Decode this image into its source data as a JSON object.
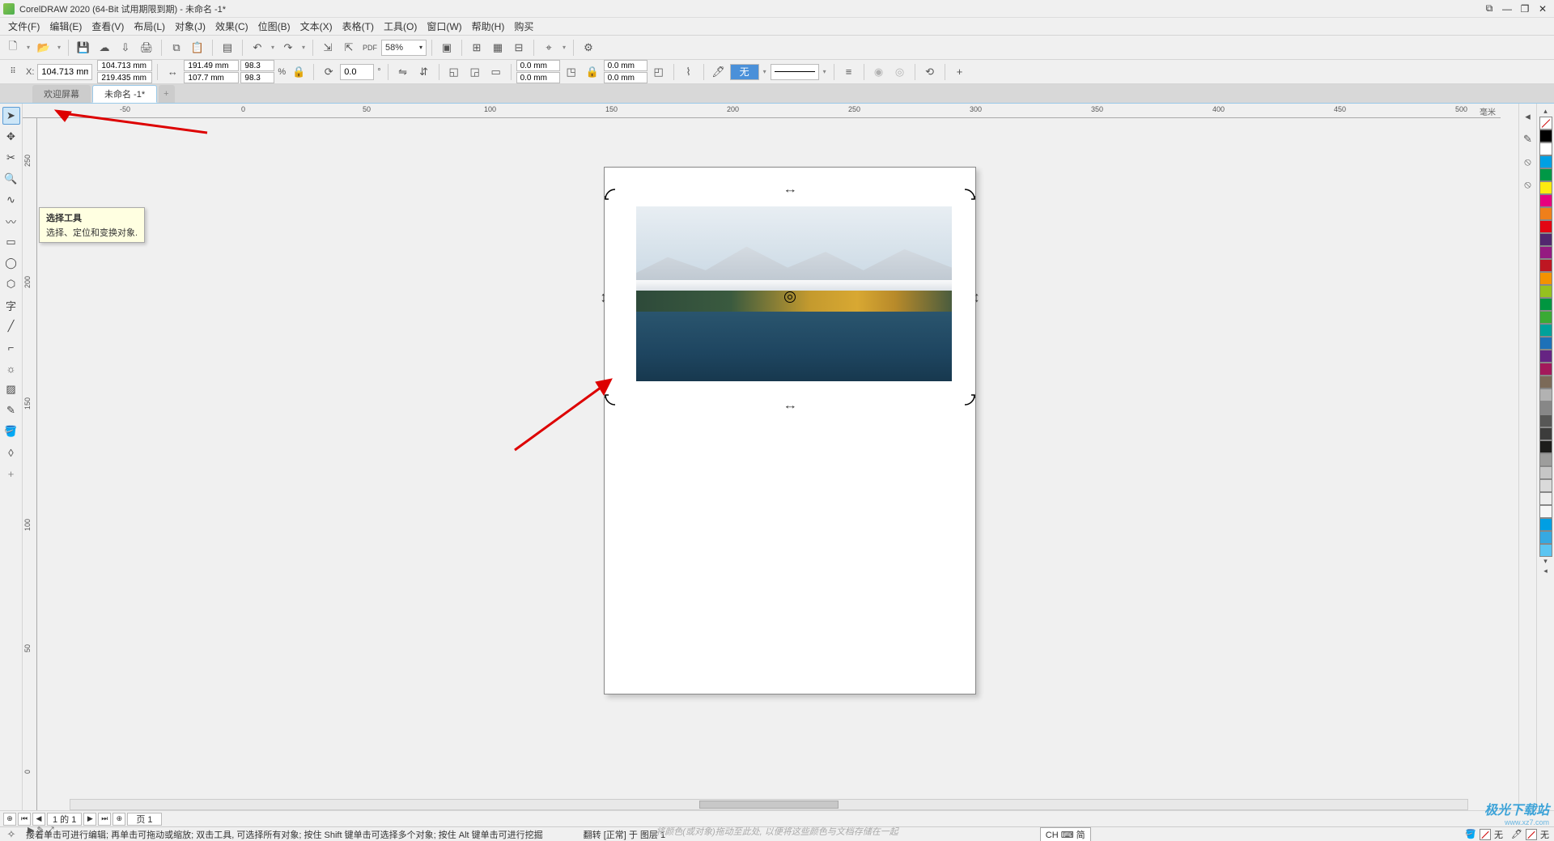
{
  "title": "CorelDRAW 2020 (64-Bit 试用期限到期) - 未命名 -1*",
  "menu": [
    "文件(F)",
    "编辑(E)",
    "查看(V)",
    "布局(L)",
    "对象(J)",
    "效果(C)",
    "位图(B)",
    "文本(X)",
    "表格(T)",
    "工具(O)",
    "窗口(W)",
    "帮助(H)",
    "购买"
  ],
  "toolbar1": {
    "zoom": "58%"
  },
  "propbar": {
    "x": "104.713 mm",
    "y": "219.435 mm",
    "w": "191.49 mm",
    "h": "107.7 mm",
    "sx": "98.3",
    "sy": "98.3",
    "sunit": "%",
    "rot": "0.0",
    "out1": "0.0 mm",
    "out2": "0.0 mm",
    "out3": "0.0 mm",
    "out4": "0.0 mm",
    "fill": "无"
  },
  "tabs": {
    "welcome": "欢迎屏幕",
    "doc": "未命名 -1*"
  },
  "tooltip": {
    "title": "选择工具",
    "desc": "选择、定位和变换对象."
  },
  "ruler_unit": "毫米",
  "hruler_ticks": [
    -50,
    0,
    50,
    100,
    150,
    200,
    250,
    300,
    350,
    400,
    450,
    500
  ],
  "vruler_ticks": [
    250,
    200,
    150,
    100,
    50,
    0
  ],
  "palette": [
    "#000000",
    "#ffffff",
    "#00a0e3",
    "#009846",
    "#fcea10",
    "#e6007e",
    "#ef7f1a",
    "#e30613",
    "#52286f",
    "#951b81",
    "#be1622",
    "#f39200",
    "#95c11f",
    "#009640",
    "#3aaa35",
    "#00a19a",
    "#1d71b8",
    "#662483",
    "#a3195b",
    "#7b6a58",
    "#b2b2b2",
    "#878787",
    "#575756",
    "#3c3c3b",
    "#1d1d1b",
    "#9d9d9c",
    "#c6c6c6",
    "#dadada",
    "#ededed",
    "#f6f6f6",
    "#009fe3",
    "#36a9e1",
    "#5bc5f2"
  ],
  "pagenav": {
    "pos": "1 的 1",
    "page": "页 1"
  },
  "below_icons": "▶ ✎ ⤢",
  "status": {
    "hint_left": "接着单击可进行编辑; 再单击可拖动或缩放; 双击工具, 可选择所有对象; 按住 Shift 键单击可选择多个对象; 按住 Alt 键单击可进行挖掘",
    "rot": "翻转  [正常] 于 图层 1",
    "drag_hint": "将颜色(或对象)拖动至此处, 以便将这些颜色与文档存储在一起",
    "ime": "CH ⌨ 简",
    "fill_none": "无",
    "line_none": "无"
  },
  "watermark": {
    "w1": "极光下载站",
    "w2": "www.xz7.com"
  }
}
